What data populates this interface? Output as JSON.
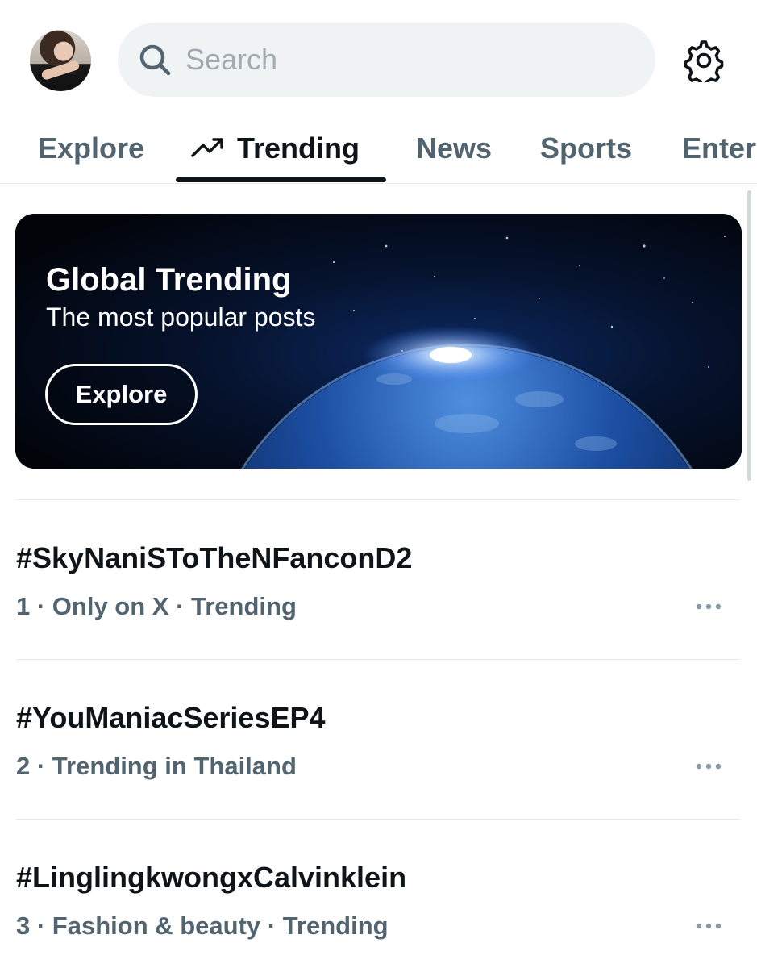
{
  "header": {
    "search_placeholder": "Search",
    "avatar_icon": "profile-avatar",
    "settings_icon": "gear-icon"
  },
  "tabs": [
    {
      "label": "Explore",
      "active": false
    },
    {
      "label": "Trending",
      "active": true,
      "icon": "trending-up-icon"
    },
    {
      "label": "News",
      "active": false
    },
    {
      "label": "Sports",
      "active": false
    },
    {
      "label": "Enter",
      "active": false
    }
  ],
  "banner": {
    "title": "Global Trending",
    "subtitle": "The most popular posts",
    "button_label": "Explore"
  },
  "trends": [
    {
      "tag": "#SkyNaniSToTheNFanconD2",
      "meta": "1 · Only on X · Trending"
    },
    {
      "tag": "#YouManiacSeriesEP4",
      "meta": "2 · Trending in Thailand"
    },
    {
      "tag": "#LinglingkwongxCalvinklein",
      "meta": "3 · Fashion & beauty · Trending"
    }
  ],
  "colors": {
    "text_primary": "#0f1419",
    "text_secondary": "#536471",
    "search_bg": "#eff3f4",
    "divider": "#e6e9ea"
  }
}
